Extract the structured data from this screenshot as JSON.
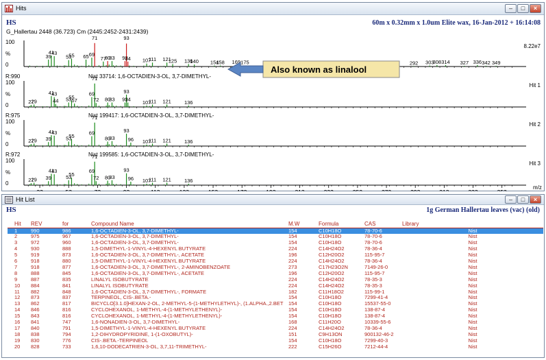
{
  "colors": {
    "peak_green": "#1a8a1a",
    "peak_red": "#cc1a1a",
    "selected_row": "#3a8ee0",
    "table_text": "#b0241b",
    "header_blue": "#1a2a7a",
    "callout_bg": "#f5e6a8",
    "arrow": "#5b86c4"
  },
  "top_window": {
    "title": "Hits",
    "icon": "spectrum-window-icon",
    "controls": {
      "minimize": "–",
      "maximize": "□",
      "close": "×"
    },
    "header_left": "HS",
    "header_right": "60m x 0.32mm x 1.0um Elite wax,  16-Jan-2012 + 16:14:08",
    "sample_line": "G_Hallertau 2448 (36.723) Cm (2445:2452-2431:2439)",
    "intensity": "8.22e7",
    "callout": "Also known as linalool",
    "x_axis": {
      "ticks": [
        "33",
        "53",
        "73",
        "93",
        "113",
        "133",
        "153",
        "173",
        "193",
        "213",
        "233",
        "253",
        "273",
        "293",
        "313",
        "333",
        "353"
      ],
      "unit": "m/z"
    },
    "y_labels": {
      "top": "100",
      "pct": "%",
      "zero": "0"
    },
    "panels": [
      {
        "r_label": "",
        "nist_text": "",
        "hit_label": "",
        "labels": [
          "39",
          "41",
          "43",
          "53",
          "55",
          "65",
          "69",
          "71",
          "77",
          "80",
          "83",
          "92",
          "93",
          "94",
          "107",
          "111",
          "121",
          "125",
          "136",
          "140",
          "154",
          "158",
          "169",
          "175",
          "196",
          "210",
          "229",
          "238",
          "250",
          "292",
          "303",
          "308",
          "314",
          "327",
          "336",
          "342",
          "349"
        ]
      },
      {
        "r_label": "R:990",
        "nist_text": "Nist  33714: 1,6-OCTADIEN-3-OL, 3,7-DIMETHYL-",
        "hit_label": "Hit 1",
        "labels": [
          "27",
          "29",
          "41",
          "43",
          "44",
          "53",
          "55",
          "57",
          "69",
          "71",
          "72",
          "80",
          "83",
          "92",
          "93",
          "94",
          "107",
          "111",
          "121",
          "136"
        ]
      },
      {
        "r_label": "R:975",
        "nist_text": "Nist  199417: 1,6-OCTADIEN-3-OL, 3,7-DIMETHYL-",
        "hit_label": "Hit 2",
        "labels": [
          "27",
          "29",
          "39",
          "41",
          "43",
          "53",
          "55",
          "69",
          "71",
          "80",
          "83",
          "93",
          "96",
          "107",
          "111",
          "121",
          "136"
        ]
      },
      {
        "r_label": "R:972",
        "nist_text": "Nist  199585: 1,6-OCTADIEN-3-OL, 3,7-DIMETHYL-",
        "hit_label": "Hit 3",
        "labels": [
          "27",
          "29",
          "39",
          "41",
          "43",
          "53",
          "55",
          "69",
          "71",
          "72",
          "80",
          "83",
          "93",
          "96",
          "107",
          "111",
          "121",
          "136"
        ]
      }
    ]
  },
  "hit_list": {
    "title": "Hit List",
    "icon": "hit-list-window-icon",
    "controls": {
      "minimize": "–",
      "maximize": "□",
      "close": "×"
    },
    "header_left": "HS",
    "header_right": "1g German Hallertau leaves (vac) (old)",
    "columns": [
      "Hit",
      "REV",
      "for",
      "Compound Name",
      "M.W",
      "Formula",
      "CAS",
      "Library"
    ],
    "rows": [
      [
        "1",
        "990",
        "986",
        "1,6-OCTADIEN-3-OL, 3,7-DIMETHYL-",
        "154",
        "C10H18O",
        "78-70-6",
        "Nist"
      ],
      [
        "2",
        "975",
        "967",
        "1,6-OCTADIEN-3-OL, 3,7-DIMETHYL-",
        "154",
        "C10H18O",
        "78-70-6",
        "Nist"
      ],
      [
        "3",
        "972",
        "960",
        "1,6-OCTADIEN-3-OL, 3,7-DIMETHYL-",
        "154",
        "C10H18O",
        "78-70-6",
        "Nist"
      ],
      [
        "4",
        "930",
        "888",
        "1,5-DIMETHYL-1-VINYL-4-HEXENYL BUTYRATE",
        "224",
        "C14H24O2",
        "78-36-4",
        "Nist"
      ],
      [
        "5",
        "919",
        "873",
        "1,6-OCTADIEN-3-OL, 3,7-DIMETHYL-, ACETATE",
        "196",
        "C12H20O2",
        "115-95-7",
        "Nist"
      ],
      [
        "6",
        "918",
        "880",
        "1,5-DIMETHYL-1-VINYL-4-HEXENYL BUTYRATE",
        "224",
        "C14H24O2",
        "78-36-4",
        "Nist"
      ],
      [
        "7",
        "918",
        "877",
        "1,6-OCTADIEN-3-OL, 3,7-DIMETHYL-, 2-AMINOBENZOATE",
        "273",
        "C17H23O2N",
        "7149-26-0",
        "Nist"
      ],
      [
        "8",
        "888",
        "845",
        "1,6-OCTADIEN-3-OL, 3,7-DIMETHYL-, ACETATE",
        "196",
        "C12H20O2",
        "115-95-7",
        "Nist"
      ],
      [
        "9",
        "887",
        "835",
        "LINALYL ISOBUTYRATE",
        "224",
        "C14H24O2",
        "78-35-3",
        "Nist"
      ],
      [
        "10",
        "884",
        "841",
        "LINALYL ISOBUTYRATE",
        "224",
        "C14H24O2",
        "78-35-3",
        "Nist"
      ],
      [
        "11",
        "882",
        "848",
        "1,6-OCTADIEN-3-OL, 3,7-DIMETHYL-, FORMATE",
        "182",
        "C11H18O2",
        "115-99-1",
        "Nist"
      ],
      [
        "12",
        "873",
        "837",
        "TERPINEOL, CIS-.BETA.-",
        "154",
        "C10H18O",
        "7299-41-4",
        "Nist"
      ],
      [
        "13",
        "862",
        "817",
        "BICYCLO[3.1.0]HEXAN-2-OL, 2-METHYL-5-(1-METHYLETHYL)-, (1.ALPHA.,2.BET",
        "154",
        "C10H18O",
        "15537-55-0",
        "Nist"
      ],
      [
        "14",
        "846",
        "816",
        "CYCLOHEXANOL, 1-METHYL-4-(1-METHYLETHENYL)-",
        "154",
        "C10H18O",
        "138-87-4",
        "Nist"
      ],
      [
        "15",
        "843",
        "816",
        "CYCLOHEXANOL, 1-METHYL-4-(1-METHYLETHENYL)-",
        "154",
        "C10H18O",
        "138-87-4",
        "Nist"
      ],
      [
        "16",
        "841",
        "747",
        "1,6-NONADIEN-3-OL, 3,7-DIMETHYL-",
        "168",
        "C11H20O",
        "10339-55-6",
        "Nist"
      ],
      [
        "17",
        "840",
        "791",
        "1,5-DIMETHYL-1-VINYL-4-HEXENYL BUTYRATE",
        "224",
        "C14H24O2",
        "78-36-4",
        "Nist"
      ],
      [
        "18",
        "838",
        "794",
        "1,2-DIHYDROPYRIDINE, 1-(1-OXOBUTYL)-",
        "151",
        "C9H13ON",
        "900132-46-2",
        "Nist"
      ],
      [
        "19",
        "830",
        "776",
        "CIS-.BETA.-TERPINEOL",
        "154",
        "C10H18O",
        "7299-40-3",
        "Nist"
      ],
      [
        "20",
        "828",
        "733",
        "1,6,10-DODECATRIEN-3-OL, 3,7,11-TRIMETHYL-",
        "222",
        "C15H26O",
        "7212-44-4",
        "Nist"
      ]
    ]
  }
}
